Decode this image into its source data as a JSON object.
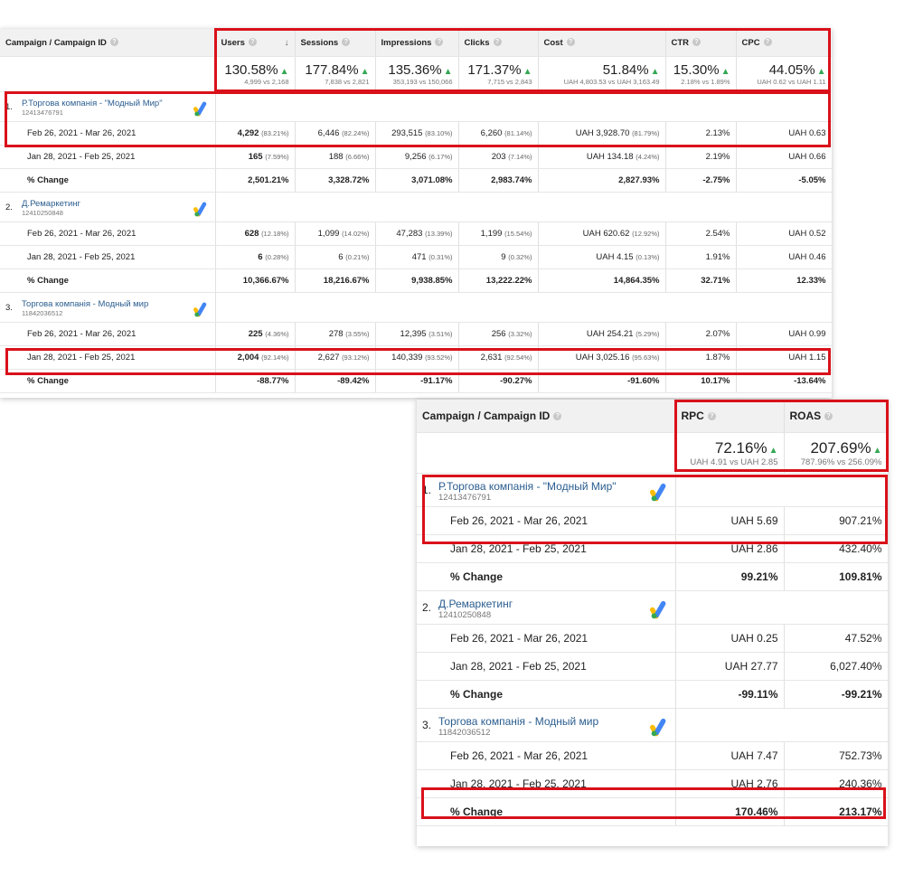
{
  "tableA": {
    "headers": {
      "campaign": "Campaign / Campaign ID",
      "users": "Users",
      "sessions": "Sessions",
      "impressions": "Impressions",
      "clicks": "Clicks",
      "cost": "Cost",
      "ctr": "CTR",
      "cpc": "CPC"
    },
    "summary": {
      "users": {
        "pct": "130.58%",
        "cmp": "4,999 vs 2,168"
      },
      "sessions": {
        "pct": "177.84%",
        "cmp": "7,838 vs 2,821"
      },
      "impressions": {
        "pct": "135.36%",
        "cmp": "353,193 vs 150,066"
      },
      "clicks": {
        "pct": "171.37%",
        "cmp": "7,715 vs 2,843"
      },
      "cost": {
        "pct": "51.84%",
        "cmp": "UAH 4,803.53 vs UAH 3,163.49"
      },
      "ctr": {
        "pct": "15.30%",
        "cmp": "2.18% vs 1.89%"
      },
      "cpc": {
        "pct": "44.05%",
        "cmp": "UAH 0.62 vs UAH 1.11"
      }
    },
    "campaigns": [
      {
        "index": "1.",
        "name": "Р.Торгова компанія - \"Модный Мир\"",
        "id": "12413476791",
        "rows": [
          {
            "label": "Feb 26, 2021 - Mar 26, 2021",
            "users": "4,292",
            "users_pct": "(83.21%)",
            "sessions": "6,446",
            "sessions_pct": "(82.24%)",
            "impressions": "293,515",
            "impressions_pct": "(83.10%)",
            "clicks": "6,260",
            "clicks_pct": "(81.14%)",
            "cost": "UAH 3,928.70",
            "cost_pct": "(81.79%)",
            "ctr": "2.13%",
            "cpc": "UAH 0.63"
          },
          {
            "label": "Jan 28, 2021 - Feb 25, 2021",
            "users": "165",
            "users_pct": "(7.59%)",
            "sessions": "188",
            "sessions_pct": "(6.66%)",
            "impressions": "9,256",
            "impressions_pct": "(6.17%)",
            "clicks": "203",
            "clicks_pct": "(7.14%)",
            "cost": "UAH 134.18",
            "cost_pct": "(4.24%)",
            "ctr": "2.19%",
            "cpc": "UAH 0.66"
          },
          {
            "label": "% Change",
            "users": "2,501.21%",
            "sessions": "3,328.72%",
            "impressions": "3,071.08%",
            "clicks": "2,983.74%",
            "cost": "2,827.93%",
            "ctr": "-2.75%",
            "cpc": "-5.05%"
          }
        ]
      },
      {
        "index": "2.",
        "name": "Д.Ремаркетинг",
        "id": "12410250848",
        "rows": [
          {
            "label": "Feb 26, 2021 - Mar 26, 2021",
            "users": "628",
            "users_pct": "(12.18%)",
            "sessions": "1,099",
            "sessions_pct": "(14.02%)",
            "impressions": "47,283",
            "impressions_pct": "(13.39%)",
            "clicks": "1,199",
            "clicks_pct": "(15.54%)",
            "cost": "UAH 620.62",
            "cost_pct": "(12.92%)",
            "ctr": "2.54%",
            "cpc": "UAH 0.52"
          },
          {
            "label": "Jan 28, 2021 - Feb 25, 2021",
            "users": "6",
            "users_pct": "(0.28%)",
            "sessions": "6",
            "sessions_pct": "(0.21%)",
            "impressions": "471",
            "impressions_pct": "(0.31%)",
            "clicks": "9",
            "clicks_pct": "(0.32%)",
            "cost": "UAH 4.15",
            "cost_pct": "(0.13%)",
            "ctr": "1.91%",
            "cpc": "UAH 0.46"
          },
          {
            "label": "% Change",
            "users": "10,366.67%",
            "sessions": "18,216.67%",
            "impressions": "9,938.85%",
            "clicks": "13,222.22%",
            "cost": "14,864.35%",
            "ctr": "32.71%",
            "cpc": "12.33%"
          }
        ]
      },
      {
        "index": "3.",
        "name": "Торгова компанія - Модный мир",
        "id": "11842036512",
        "rows": [
          {
            "label": "Feb 26, 2021 - Mar 26, 2021",
            "users": "225",
            "users_pct": "(4.36%)",
            "sessions": "278",
            "sessions_pct": "(3.55%)",
            "impressions": "12,395",
            "impressions_pct": "(3.51%)",
            "clicks": "256",
            "clicks_pct": "(3.32%)",
            "cost": "UAH 254.21",
            "cost_pct": "(5.29%)",
            "ctr": "2.07%",
            "cpc": "UAH 0.99"
          },
          {
            "label": "Jan 28, 2021 - Feb 25, 2021",
            "users": "2,004",
            "users_pct": "(92.14%)",
            "sessions": "2,627",
            "sessions_pct": "(93.12%)",
            "impressions": "140,339",
            "impressions_pct": "(93.52%)",
            "clicks": "2,631",
            "clicks_pct": "(92.54%)",
            "cost": "UAH 3,025.16",
            "cost_pct": "(95.63%)",
            "ctr": "1.87%",
            "cpc": "UAH 1.15"
          },
          {
            "label": "% Change",
            "users": "-88.77%",
            "sessions": "-89.42%",
            "impressions": "-91.17%",
            "clicks": "-90.27%",
            "cost": "-91.60%",
            "ctr": "10.17%",
            "cpc": "-13.64%"
          }
        ]
      }
    ]
  },
  "tableB": {
    "headers": {
      "campaign": "Campaign / Campaign ID",
      "rpc": "RPC",
      "roas": "ROAS"
    },
    "summary": {
      "rpc": {
        "pct": "72.16%",
        "cmp": "UAH 4.91 vs UAH 2.85"
      },
      "roas": {
        "pct": "207.69%",
        "cmp": "787.96% vs 256.09%"
      }
    },
    "campaigns": [
      {
        "index": "1.",
        "name": "Р.Торгова компанія - \"Модный Мир\"",
        "id": "12413476791",
        "rows": [
          {
            "label": "Feb 26, 2021 - Mar 26, 2021",
            "rpc": "UAH 5.69",
            "roas": "907.21%"
          },
          {
            "label": "Jan 28, 2021 - Feb 25, 2021",
            "rpc": "UAH 2.86",
            "roas": "432.40%"
          },
          {
            "label": "% Change",
            "rpc": "99.21%",
            "roas": "109.81%"
          }
        ]
      },
      {
        "index": "2.",
        "name": "Д.Ремаркетинг",
        "id": "12410250848",
        "rows": [
          {
            "label": "Feb 26, 2021 - Mar 26, 2021",
            "rpc": "UAH 0.25",
            "roas": "47.52%"
          },
          {
            "label": "Jan 28, 2021 - Feb 25, 2021",
            "rpc": "UAH 27.77",
            "roas": "6,027.40%"
          },
          {
            "label": "% Change",
            "rpc": "-99.11%",
            "roas": "-99.21%"
          }
        ]
      },
      {
        "index": "3.",
        "name": "Торгова компанія - Модный мир",
        "id": "11842036512",
        "rows": [
          {
            "label": "Feb 26, 2021 - Mar 26, 2021",
            "rpc": "UAH 7.47",
            "roas": "752.73%"
          },
          {
            "label": "Jan 28, 2021 - Feb 25, 2021",
            "rpc": "UAH 2.76",
            "roas": "240.36%"
          },
          {
            "label": "% Change",
            "rpc": "170.46%",
            "roas": "213.17%"
          }
        ]
      }
    ]
  },
  "colors": {
    "highlight": "#d9111a",
    "link": "#2a5d8f",
    "up_arrow": "#34a853"
  },
  "icons": {
    "ads": "google-ads-icon",
    "help": "help-icon",
    "sort": "sort-arrow-down-icon",
    "trend": "trend-up-icon"
  }
}
